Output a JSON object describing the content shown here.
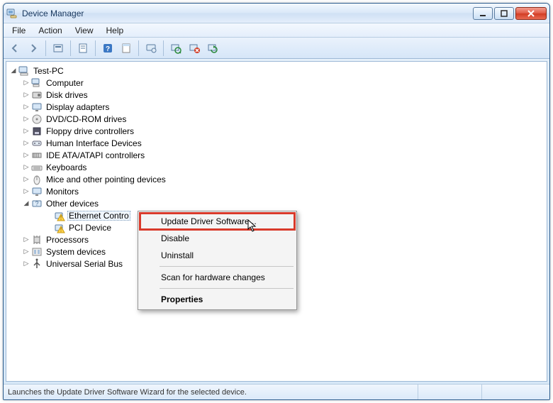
{
  "window": {
    "title": "Device Manager"
  },
  "menubar": {
    "items": [
      "File",
      "Action",
      "View",
      "Help"
    ]
  },
  "toolbar": {
    "buttons": [
      {
        "name": "back",
        "icon": "arrow-left-icon"
      },
      {
        "name": "forward",
        "icon": "arrow-right-icon"
      },
      {
        "name": "sep"
      },
      {
        "name": "show-hidden",
        "icon": "box-icon"
      },
      {
        "name": "sep"
      },
      {
        "name": "properties",
        "icon": "page-icon"
      },
      {
        "name": "sep"
      },
      {
        "name": "help",
        "icon": "help-icon"
      },
      {
        "name": "help-topics",
        "icon": "page2-icon"
      },
      {
        "name": "sep"
      },
      {
        "name": "computer",
        "icon": "monitor-icon"
      },
      {
        "name": "sep"
      },
      {
        "name": "scan-hw",
        "icon": "scan-icon"
      },
      {
        "name": "uninstall",
        "icon": "uninstall-icon"
      },
      {
        "name": "update-driver",
        "icon": "update-icon"
      }
    ]
  },
  "tree": {
    "root": {
      "label": "Test-PC",
      "icon": "computer"
    },
    "children": [
      {
        "label": "Computer",
        "icon": "computer-small"
      },
      {
        "label": "Disk drives",
        "icon": "disk"
      },
      {
        "label": "Display adapters",
        "icon": "display"
      },
      {
        "label": "DVD/CD-ROM drives",
        "icon": "cd"
      },
      {
        "label": "Floppy drive controllers",
        "icon": "floppy"
      },
      {
        "label": "Human Interface Devices",
        "icon": "hid"
      },
      {
        "label": "IDE ATA/ATAPI controllers",
        "icon": "ide"
      },
      {
        "label": "Keyboards",
        "icon": "keyboard"
      },
      {
        "label": "Mice and other pointing devices",
        "icon": "mouse"
      },
      {
        "label": "Monitors",
        "icon": "monitor"
      },
      {
        "label": "Other devices",
        "icon": "other",
        "expanded": true,
        "children": [
          {
            "label": "Ethernet Contro",
            "icon": "warn",
            "selected": true
          },
          {
            "label": "PCI Device",
            "icon": "warn"
          }
        ]
      },
      {
        "label": "Processors",
        "icon": "cpu"
      },
      {
        "label": "System devices",
        "icon": "system"
      },
      {
        "label": "Universal Serial Bus",
        "icon": "usb"
      }
    ]
  },
  "context_menu": {
    "items": [
      {
        "label": "Update Driver Software...",
        "highlight": true
      },
      {
        "label": "Disable"
      },
      {
        "label": "Uninstall"
      },
      {
        "sep": true
      },
      {
        "label": "Scan for hardware changes"
      },
      {
        "sep": true
      },
      {
        "label": "Properties",
        "bold": true
      }
    ]
  },
  "statusbar": {
    "text": "Launches the Update Driver Software Wizard for the selected device."
  }
}
